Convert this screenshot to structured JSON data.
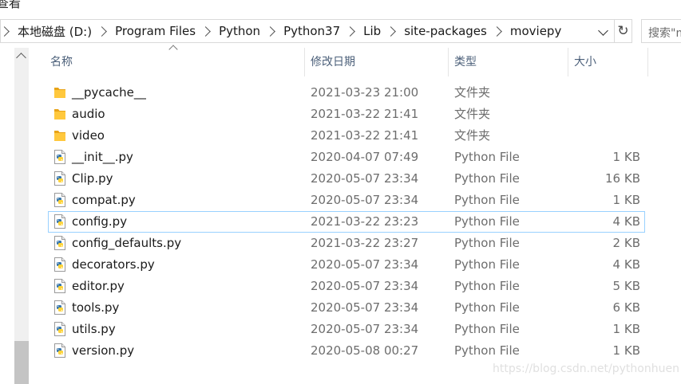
{
  "menu": {
    "view_label": "查看"
  },
  "address": {
    "crumbs": [
      "本地磁盘 (D:)",
      "Program Files",
      "Python",
      "Python37",
      "Lib",
      "site-packages",
      "moviepy"
    ]
  },
  "search": {
    "placeholder": "搜索\"m"
  },
  "columns": {
    "name": "名称",
    "date": "修改日期",
    "type": "类型",
    "size": "大小"
  },
  "files": [
    {
      "name": "__pycache__",
      "date": "2021-03-23 21:00",
      "type": "文件夹",
      "size": "",
      "kind": "folder"
    },
    {
      "name": "audio",
      "date": "2021-03-22 21:41",
      "type": "文件夹",
      "size": "",
      "kind": "folder"
    },
    {
      "name": "video",
      "date": "2021-03-22 21:41",
      "type": "文件夹",
      "size": "",
      "kind": "folder"
    },
    {
      "name": "__init__.py",
      "date": "2020-04-07 07:49",
      "type": "Python File",
      "size": "1 KB",
      "kind": "python"
    },
    {
      "name": "Clip.py",
      "date": "2020-05-07 23:34",
      "type": "Python File",
      "size": "16 KB",
      "kind": "python"
    },
    {
      "name": "compat.py",
      "date": "2020-05-07 23:34",
      "type": "Python File",
      "size": "1 KB",
      "kind": "python"
    },
    {
      "name": "config.py",
      "date": "2021-03-22 23:23",
      "type": "Python File",
      "size": "4 KB",
      "kind": "python",
      "selected": true
    },
    {
      "name": "config_defaults.py",
      "date": "2021-03-22 23:27",
      "type": "Python File",
      "size": "2 KB",
      "kind": "python"
    },
    {
      "name": "decorators.py",
      "date": "2020-05-07 23:34",
      "type": "Python File",
      "size": "4 KB",
      "kind": "python"
    },
    {
      "name": "editor.py",
      "date": "2020-05-07 23:34",
      "type": "Python File",
      "size": "5 KB",
      "kind": "python"
    },
    {
      "name": "tools.py",
      "date": "2020-05-07 23:34",
      "type": "Python File",
      "size": "6 KB",
      "kind": "python"
    },
    {
      "name": "utils.py",
      "date": "2020-05-07 23:34",
      "type": "Python File",
      "size": "1 KB",
      "kind": "python"
    },
    {
      "name": "version.py",
      "date": "2020-05-08 00:27",
      "type": "Python File",
      "size": "1 KB",
      "kind": "python"
    }
  ],
  "watermark": "https://blog.csdn.net/pythonhuen",
  "colors": {
    "folder": "#ffc83d",
    "selection_border": "#99d1ff",
    "header_text": "#4c607a"
  }
}
